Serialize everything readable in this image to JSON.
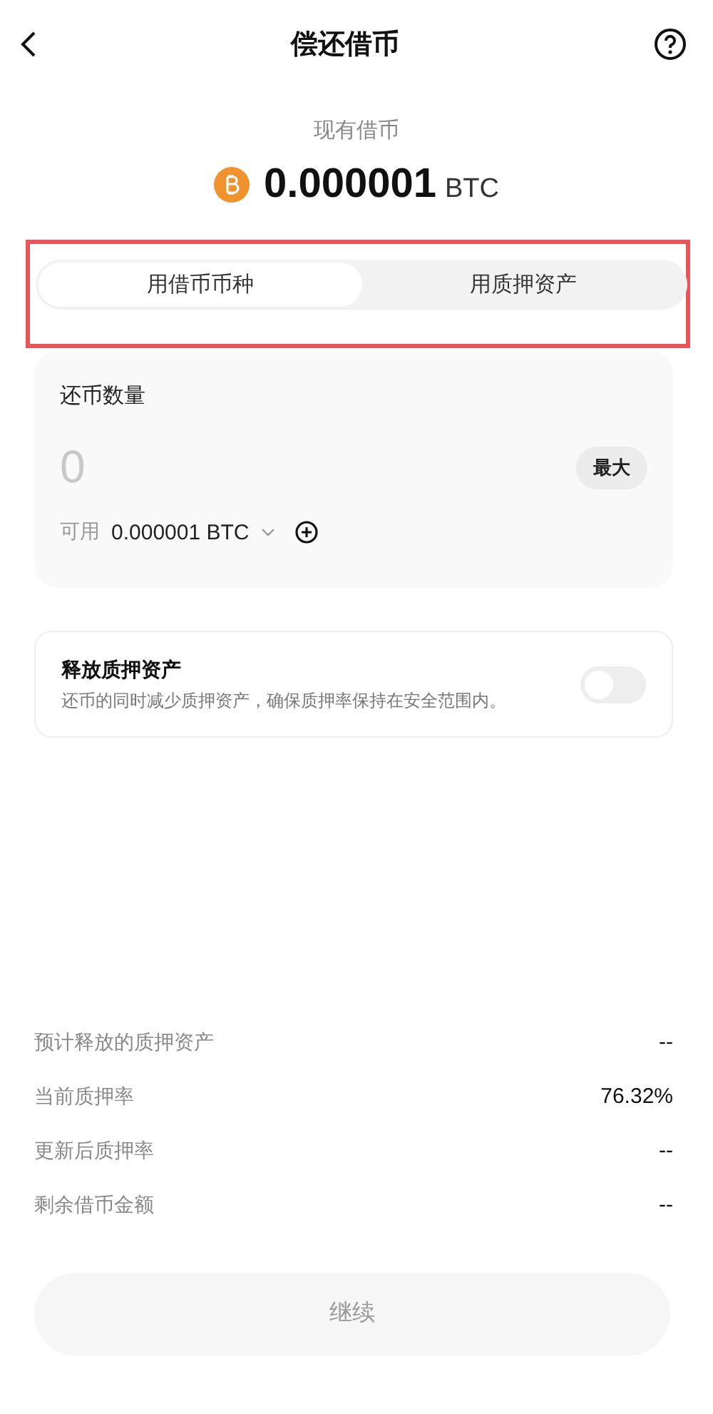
{
  "header": {
    "title": "偿还借币"
  },
  "loan": {
    "label": "现有借币",
    "amount": "0.000001",
    "unit": "BTC"
  },
  "tabs": [
    {
      "label": "用借币币种",
      "selected": true
    },
    {
      "label": "用质押资产",
      "selected": false
    }
  ],
  "repay": {
    "label": "还币数量",
    "placeholder": "0",
    "max_button": "最大",
    "available_label": "可用",
    "available_value": "0.000001 BTC"
  },
  "release": {
    "title": "释放质押资产",
    "description": "还币的同时减少质押资产，确保质押率保持在安全范围内。",
    "on": false
  },
  "summary": [
    {
      "label": "预计释放的质押资产",
      "value": "--"
    },
    {
      "label": "当前质押率",
      "value": "76.32%"
    },
    {
      "label": "更新后质押率",
      "value": "--"
    },
    {
      "label": "剩余借币金额",
      "value": "--"
    }
  ],
  "continue_button": {
    "label": "继续",
    "disabled": true
  }
}
